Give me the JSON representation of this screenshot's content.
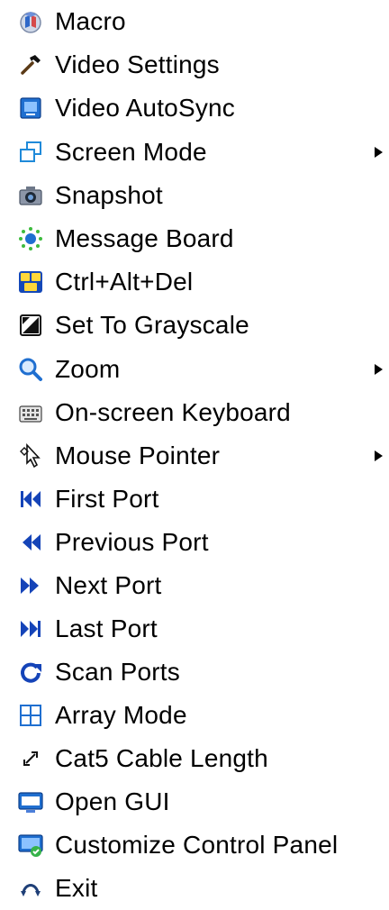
{
  "menu": {
    "items": [
      {
        "label": "Macro",
        "icon": "macro-icon",
        "submenu": false
      },
      {
        "label": "Video Settings",
        "icon": "hammer-icon",
        "submenu": false
      },
      {
        "label": "Video AutoSync",
        "icon": "video-autosync-icon",
        "submenu": false
      },
      {
        "label": "Screen Mode",
        "icon": "screen-mode-icon",
        "submenu": true
      },
      {
        "label": "Snapshot",
        "icon": "camera-icon",
        "submenu": false
      },
      {
        "label": "Message Board",
        "icon": "message-board-icon",
        "submenu": false
      },
      {
        "label": "Ctrl+Alt+Del",
        "icon": "ctrl-alt-del-icon",
        "submenu": false
      },
      {
        "label": "Set To Grayscale",
        "icon": "grayscale-icon",
        "submenu": false
      },
      {
        "label": "Zoom",
        "icon": "zoom-icon",
        "submenu": true
      },
      {
        "label": "On-screen Keyboard",
        "icon": "keyboard-icon",
        "submenu": false
      },
      {
        "label": "Mouse Pointer",
        "icon": "mouse-pointer-icon",
        "submenu": true
      },
      {
        "label": "First Port",
        "icon": "first-port-icon",
        "submenu": false
      },
      {
        "label": "Previous Port",
        "icon": "previous-port-icon",
        "submenu": false
      },
      {
        "label": "Next Port",
        "icon": "next-port-icon",
        "submenu": false
      },
      {
        "label": "Last Port",
        "icon": "last-port-icon",
        "submenu": false
      },
      {
        "label": "Scan Ports",
        "icon": "scan-ports-icon",
        "submenu": false
      },
      {
        "label": "Array Mode",
        "icon": "array-mode-icon",
        "submenu": false
      },
      {
        "label": "Cat5 Cable Length",
        "icon": "cable-length-icon",
        "submenu": false
      },
      {
        "label": "Open GUI",
        "icon": "gui-icon",
        "submenu": false
      },
      {
        "label": "Customize Control Panel",
        "icon": "control-panel-icon",
        "submenu": false
      },
      {
        "label": "Exit",
        "icon": "exit-icon",
        "submenu": false
      }
    ]
  },
  "colors": {
    "text": "#000000",
    "background": "#ffffff",
    "accent_blue": "#1f6fd0",
    "dark_blue": "#1544b8"
  }
}
